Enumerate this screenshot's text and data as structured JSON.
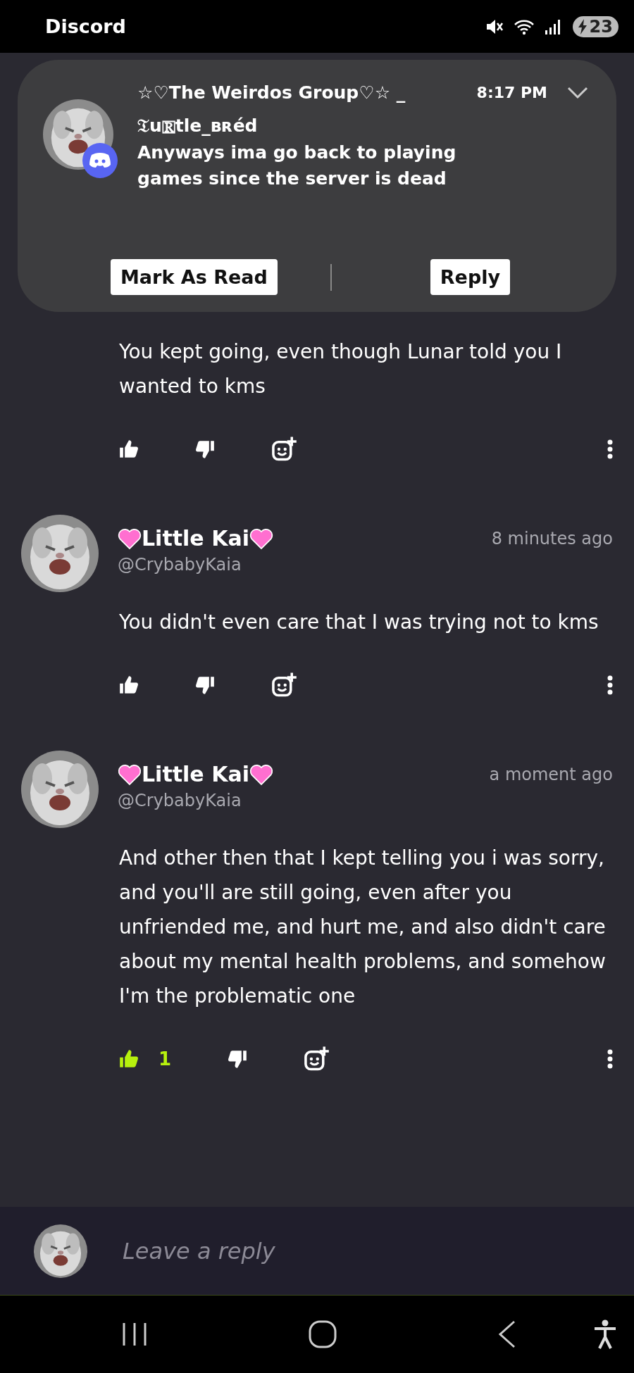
{
  "status_bar": {
    "app": "Discord",
    "battery": "23"
  },
  "notification": {
    "group": "☆♡The Weirdos Group♡☆ _",
    "time": "8:17 PM",
    "sender": "𝔗u🅁tle_ʙʀéd",
    "message": "Anyways ima go back to playing games since the server is dead",
    "actions": [
      "Mark As Read",
      "Reply"
    ]
  },
  "comments": [
    {
      "text": "You kept going, even though Lunar told you I wanted to kms",
      "liked": false
    },
    {
      "name": "Little Kai",
      "handle": "@CrybabyKaia",
      "time": "8 minutes ago",
      "text": "You didn't even care that I was trying not to kms",
      "liked": false
    },
    {
      "name": "Little Kai",
      "handle": "@CrybabyKaia",
      "time": "a moment ago",
      "text": "And other then that I kept telling you i was sorry, and you'll are still going, even after you unfriended me, and hurt me, and also didn't care about my mental health problems, and somehow I'm the problematic one",
      "liked": true,
      "likes": "1"
    }
  ],
  "reply_field": {
    "placeholder": "Leave a reply"
  }
}
